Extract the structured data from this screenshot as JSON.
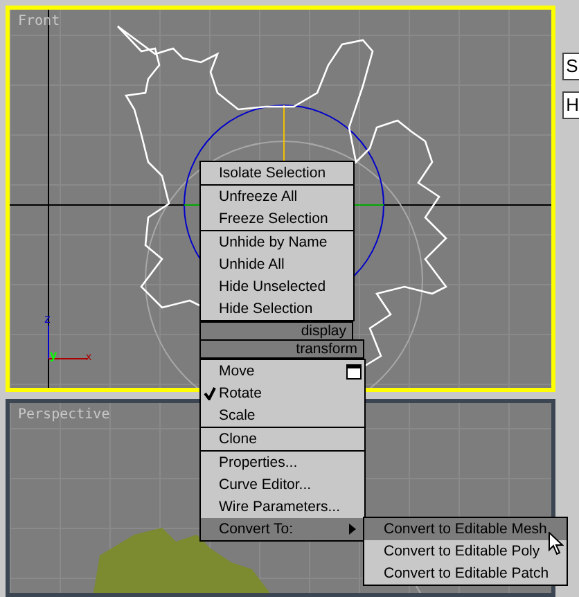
{
  "viewports": [
    {
      "label": "Front",
      "selected": true
    },
    {
      "label": "Perspective",
      "selected": false
    }
  ],
  "axis_labels": [
    "z",
    "y",
    "x"
  ],
  "side_panel": {
    "fields": [
      "S",
      "H"
    ]
  },
  "quad_menu": {
    "upper": {
      "header": "display",
      "groups": [
        [
          "Isolate Selection"
        ],
        [
          "Unfreeze All",
          "Freeze Selection"
        ],
        [
          "Unhide by Name",
          "Unhide All",
          "Hide Unselected",
          "Hide Selection"
        ]
      ]
    },
    "lower": {
      "header": "transform",
      "groups": [
        [
          {
            "label": "Move",
            "kind": "icon",
            "checked": false,
            "selected": false
          },
          {
            "label": "Rotate",
            "kind": "plain",
            "checked": true,
            "selected": false
          },
          {
            "label": "Scale",
            "kind": "plain",
            "checked": false,
            "selected": false
          }
        ],
        [
          {
            "label": "Clone",
            "kind": "plain",
            "checked": false,
            "selected": false
          }
        ],
        [
          {
            "label": "Properties...",
            "kind": "plain",
            "checked": false,
            "selected": false
          },
          {
            "label": "Curve Editor...",
            "kind": "plain",
            "checked": false,
            "selected": false
          },
          {
            "label": "Wire Parameters...",
            "kind": "plain",
            "checked": false,
            "selected": false
          },
          {
            "label": "Convert To:",
            "kind": "submenu",
            "checked": false,
            "selected": true
          }
        ]
      ]
    }
  },
  "submenu": [
    {
      "label": "Convert to Editable Mesh",
      "selected": true
    },
    {
      "label": "Convert to Editable Poly",
      "selected": false
    },
    {
      "label": "Convert to Editable Patch",
      "selected": false
    }
  ]
}
